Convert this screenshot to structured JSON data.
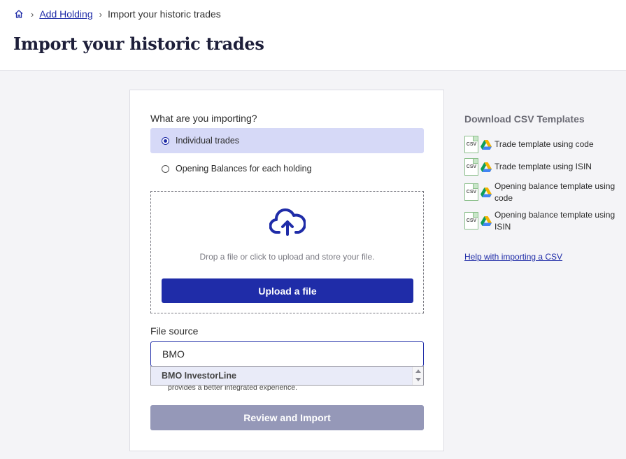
{
  "breadcrumb": {
    "home_icon": "home-icon",
    "parent": "Add Holding",
    "current": "Import your historic trades"
  },
  "page": {
    "title": "Import your historic trades"
  },
  "import_form": {
    "question": "What are you importing?",
    "options": [
      {
        "label": "Individual trades",
        "selected": true
      },
      {
        "label": "Opening Balances for each holding",
        "selected": false
      }
    ],
    "dropzone": {
      "icon": "cloud-upload-icon",
      "text": "Drop a file or click to upload and store your file.",
      "button": "Upload a file"
    },
    "file_source": {
      "label": "File source",
      "value": "BMO",
      "suggestion": "BMO InvestorLine",
      "note": "provides a better integrated experience."
    },
    "submit": "Review and Import"
  },
  "templates": {
    "title": "Download CSV Templates",
    "items": [
      {
        "label": "Trade template using code"
      },
      {
        "label": "Trade template using ISIN"
      },
      {
        "label": "Opening balance template using code"
      },
      {
        "label": "Opening balance template using ISIN"
      }
    ],
    "csv_icon_text": "CSV",
    "help_link": "Help with importing a CSV"
  },
  "colors": {
    "accent": "#1f2ca8",
    "selected_bg": "#d6d9f7",
    "disabled_button": "#9598b8"
  }
}
